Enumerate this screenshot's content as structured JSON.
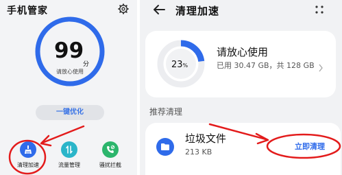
{
  "left": {
    "title": "手机管家",
    "score": "99",
    "score_unit": "分",
    "score_caption": "请放心使用",
    "optimize_button": "一键优化",
    "tools": [
      {
        "label": "清理加速",
        "icon": "broom-icon",
        "color": "#2f6bea"
      },
      {
        "label": "流量管理",
        "icon": "traffic-icon",
        "color": "#2bb5c9"
      },
      {
        "label": "骚扰拦截",
        "icon": "phone-block-icon",
        "color": "#2cb56c"
      }
    ]
  },
  "right": {
    "title": "清理加速",
    "storage": {
      "percent": "23",
      "percent_sign": "%",
      "usage_fraction": 0.23,
      "heading": "请放心使用",
      "detail": "已用 30.47 GB，共 128 GB"
    },
    "section_title": "推荐清理",
    "junk": {
      "name": "垃圾文件",
      "size": "213 KB",
      "button": "立即清理"
    }
  },
  "colors": {
    "accent": "#2f6bea",
    "ring_light": "#cfe0fa",
    "ring_track": "#e9eaed",
    "annotation_red": "#e31b1b"
  }
}
